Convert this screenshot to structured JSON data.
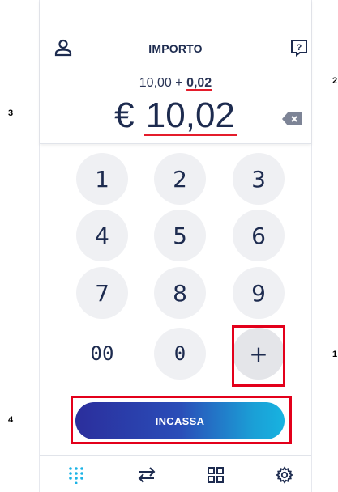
{
  "header": {
    "title": "IMPORTO",
    "calc_prefix": "10,00 + ",
    "calc_last": "0,02",
    "currency": "€",
    "amount": "10,02"
  },
  "keypad": {
    "keys": [
      "1",
      "2",
      "3",
      "4",
      "5",
      "6",
      "7",
      "8",
      "9",
      "00",
      "0",
      "+"
    ]
  },
  "action": {
    "label": "INCASSA"
  },
  "annotations": {
    "labels": [
      "1",
      "2",
      "3",
      "4"
    ]
  },
  "colors": {
    "accent_red": "#e3001b",
    "cta_gradient": [
      "#2b2e9c",
      "#17b3e0"
    ],
    "key_bg": "#eff0f3",
    "text": "#1d2b4f",
    "nav_active": "#1bb3e6"
  },
  "icons": [
    "user-icon",
    "help-icon",
    "backspace-icon",
    "keypad-icon",
    "transfer-arrows-icon",
    "grid-icon",
    "gear-icon"
  ]
}
